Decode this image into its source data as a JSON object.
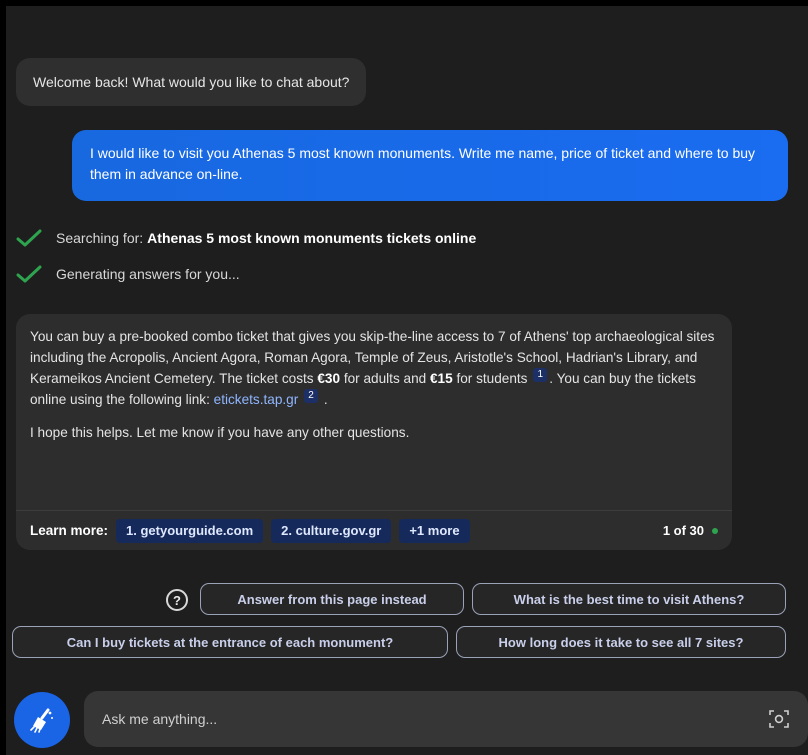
{
  "chat": {
    "welcome": "Welcome back! What would you like to chat about?",
    "user_message": "I would like to visit you Athenas 5 most known monuments. Write me name, price of ticket and where to buy them in advance on-line.",
    "status": [
      {
        "prefix": "Searching for:",
        "bold": "Athenas 5 most known monuments tickets online"
      },
      {
        "prefix": "Generating answers for you...",
        "bold": ""
      }
    ],
    "answer": {
      "p1_part1": "You can buy a pre-booked combo ticket that gives you skip-the-line access to 7 of Athens' top archaeological sites including the Acropolis, Ancient Agora, Roman Agora, Temple of Zeus, Aristotle's School, Hadrian's Library, and Kerameikos Ancient Cemetery. The ticket costs ",
      "price_adult": "€30",
      "p1_part2": " for adults and ",
      "price_student": "€15",
      "p1_part3": " for students",
      "cite1": "1",
      "p1_part4": ". You can buy the tickets online using the following link: ",
      "link": "etickets.tap.gr",
      "cite2": "2",
      "p1_part5": ".",
      "p2": "I hope this helps. Let me know if you have any other questions."
    },
    "learn_more": {
      "label": "Learn more:",
      "sources": [
        "1. getyourguide.com",
        "2. culture.gov.gr",
        "+1 more"
      ],
      "counter": "1 of 30"
    }
  },
  "suggestions": {
    "help_glyph": "?",
    "items": [
      "Answer from this page instead",
      "What is the best time to visit Athens?",
      "Can I buy tickets at the entrance of each monument?",
      "How long does it take to see all 7 sites?"
    ]
  },
  "input": {
    "placeholder": "Ask me anything..."
  },
  "colors": {
    "user_bubble": "#1a6cf0",
    "check_green": "#2ea44f",
    "source_chip": "#15295a",
    "broom_button": "#1a64e6"
  },
  "icons": {
    "status": "check-icon",
    "help": "help-icon",
    "input": "camera-icon",
    "new_topic": "broom-icon"
  }
}
